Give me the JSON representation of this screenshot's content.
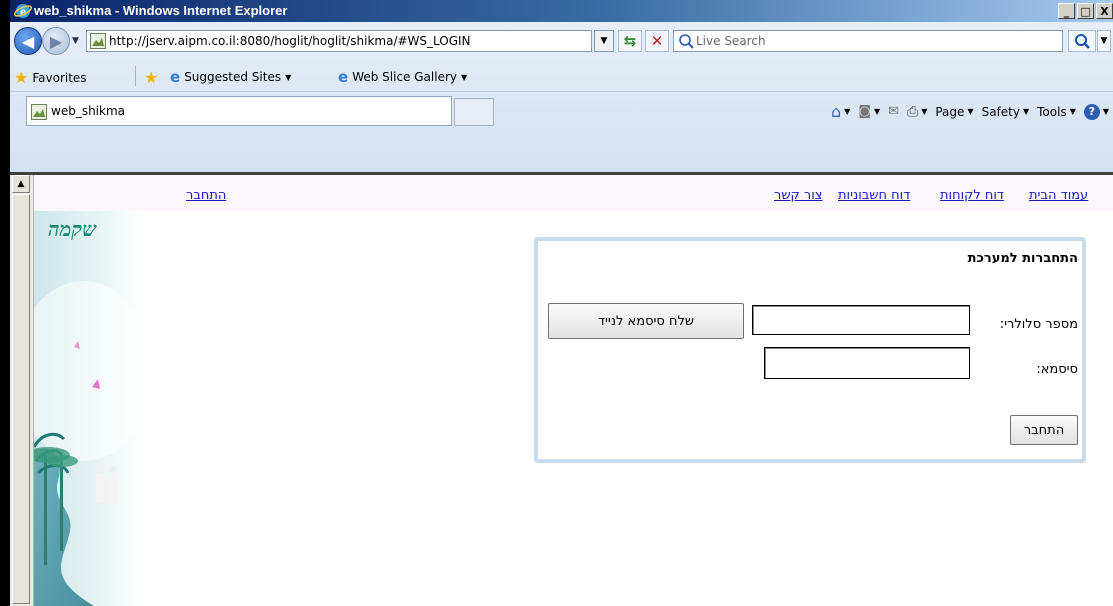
{
  "window": {
    "title": "web_shikma - Windows Internet Explorer",
    "buttons": [
      "_",
      "□",
      "X"
    ]
  },
  "address": {
    "url": "http://jserv.aipm.co.il:8080/hoglit/hoglit/shikma/#WS_LOGIN",
    "search_placeholder": "Live Search"
  },
  "favorites": {
    "label": "Favorites",
    "items": [
      {
        "label": "Suggested Sites",
        "has_menu": true
      },
      {
        "label": "Web Slice Gallery",
        "has_menu": true
      }
    ]
  },
  "tab": {
    "label": "web_shikma"
  },
  "commandbar": {
    "page": "Page",
    "safety": "Safety",
    "tools": "Tools"
  },
  "site": {
    "nav_left": "התחבר",
    "nav_links": [
      "עמוד הבית",
      "דוח לקוחות",
      "דוח חשבוניות",
      "צור קשר"
    ],
    "logo_text": "שקמה"
  },
  "login": {
    "heading": "התחברות למערכת",
    "phone_label": "מספר סלולרי:",
    "password_label": "סיסמא:",
    "send_sms_button": "שלח סיסמא לנייד",
    "login_button": "התחבר"
  },
  "colors": {
    "link": "#1a1ac6",
    "login_border": "#c6dcee",
    "titlebar": "#0a246a"
  }
}
